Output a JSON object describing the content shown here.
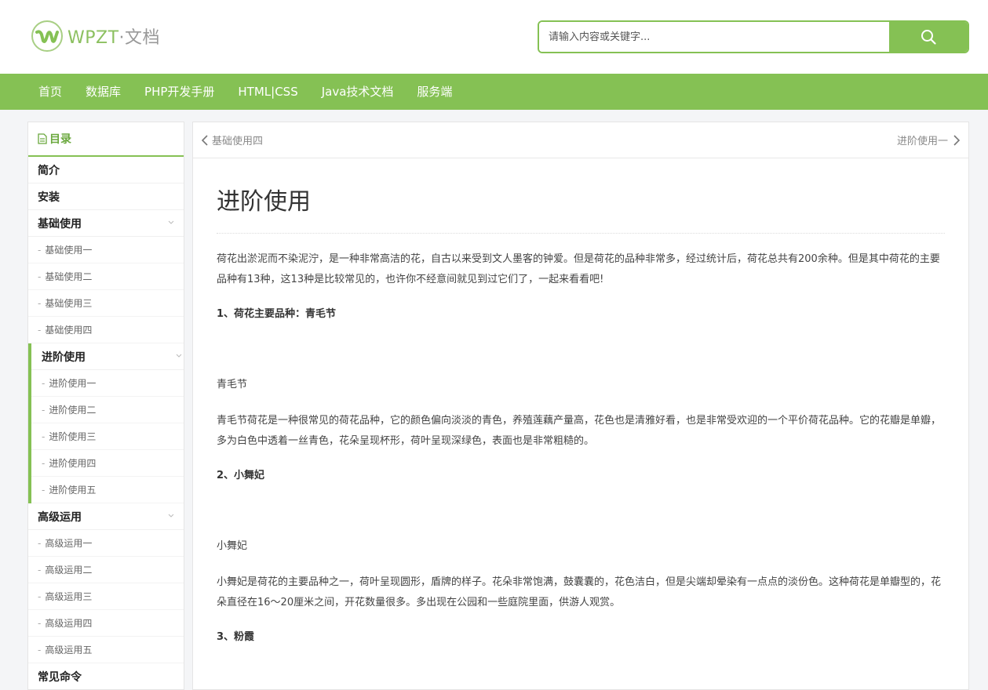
{
  "header": {
    "logo_text": "WPZT",
    "logo_sep": "·",
    "logo_cn": "文档",
    "search_placeholder": "请输入内容或关键字...",
    "brand_color": "#85c154"
  },
  "nav": [
    "首页",
    "数据库",
    "PHP开发手册",
    "HTML|CSS",
    "Java技术文档",
    "服务端"
  ],
  "toc": {
    "title": "目录",
    "items": [
      {
        "label": "简介"
      },
      {
        "label": "安装"
      },
      {
        "label": "基础使用",
        "subs": [
          "基础使用一",
          "基础使用二",
          "基础使用三",
          "基础使用四"
        ]
      },
      {
        "label": "进阶使用",
        "active": true,
        "subs": [
          "进阶使用一",
          "进阶使用二",
          "进阶使用三",
          "进阶使用四",
          "进阶使用五"
        ]
      },
      {
        "label": "高级运用",
        "subs": [
          "高级运用一",
          "高级运用二",
          "高级运用三",
          "高级运用四",
          "高级运用五"
        ]
      },
      {
        "label": "常见命令"
      }
    ]
  },
  "pager": {
    "prev": "基础使用四",
    "next": "进阶使用一"
  },
  "article": {
    "title": "进阶使用",
    "intro": "荷花出淤泥而不染泥泞，是一种非常高洁的花，自古以来受到文人墨客的钟爱。但是荷花的品种非常多，经过统计后，荷花总共有200余种。但是其中荷花的主要品种有13种，这13种是比较常见的，也许你不经意间就见到过它们了，一起来看看吧!",
    "sections": [
      {
        "heading": "1、荷花主要品种：青毛节",
        "caption": "青毛节",
        "text": "青毛节荷花是一种很常见的荷花品种，它的颜色偏向淡淡的青色，养殖莲藕产量高，花色也是清雅好看，也是非常受欢迎的一个平价荷花品种。它的花瓣是单瓣，多为白色中透着一丝青色，花朵呈现杯形，荷叶呈现深绿色，表面也是非常粗糙的。"
      },
      {
        "heading": "2、小舞妃",
        "caption": "小舞妃",
        "text": "小舞妃是荷花的主要品种之一，荷叶呈现圆形，盾牌的样子。花朵非常饱满，鼓囊囊的，花色洁白，但是尖端却晕染有一点点的淡份色。这种荷花是单瓣型的，花朵直径在16～20厘米之间，开花数量很多。多出现在公园和一些庭院里面，供游人观赏。"
      },
      {
        "heading": "3、粉霞"
      }
    ]
  }
}
